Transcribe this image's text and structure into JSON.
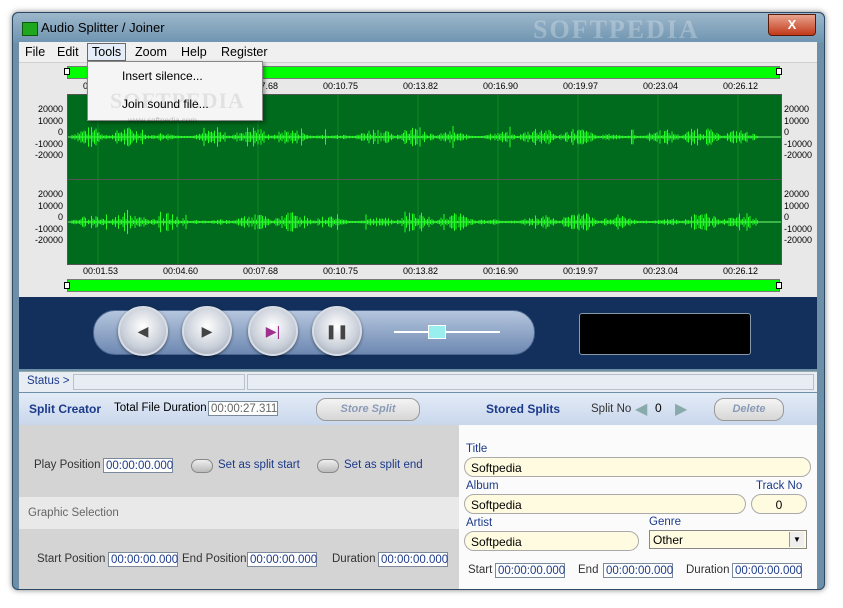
{
  "window": {
    "title": "Audio Splitter / Joiner",
    "close_label": "X"
  },
  "watermark": "SOFTPEDIA",
  "menu": [
    "File",
    "Edit",
    "Tools",
    "Zoom",
    "Help",
    "Register"
  ],
  "tools_menu": {
    "items": [
      "Insert silence...",
      "Join sound file..."
    ],
    "watermark": "SOFTPEDIA",
    "watermark_url": "www.softpedia.com"
  },
  "timeline": {
    "ticks": [
      "00:01.53",
      "00:04.60",
      "00:07.68",
      "00:10.75",
      "00:13.82",
      "00:16.90",
      "00:19.97",
      "00:23.04",
      "00:26.12"
    ]
  },
  "amplitude_labels": [
    "20000",
    "10000",
    "0",
    "-10000",
    "-20000"
  ],
  "colors": {
    "waveform": "#00ff00",
    "wave_bg": "#006b1c",
    "transport_bg": "#13305c",
    "accent_text": "#1b3a8a"
  },
  "transport": {
    "buttons": [
      "rewind",
      "play",
      "skip-marked",
      "pause"
    ],
    "icons": {
      "rewind": "◀",
      "play": "▶",
      "skip": "▶|",
      "pause": "❚❚"
    }
  },
  "status": {
    "label": "Status >"
  },
  "split_creator": {
    "title": "Split Creator",
    "total_duration_label": "Total File Duration",
    "total_duration_value": "00:00:27.311",
    "store_split_label": "Store Split",
    "play_position_label": "Play Position",
    "play_position_value": "00:00:00.000",
    "set_start_label": "Set as split start",
    "set_end_label": "Set as split end",
    "graphic_selection_label": "Graphic Selection",
    "start_position_label": "Start Position",
    "start_position_value": "00:00:00.000",
    "end_position_label": "End Position",
    "end_position_value": "00:00:00.000",
    "duration_label": "Duration",
    "duration_value": "00:00:00.000"
  },
  "stored_splits": {
    "title": "Stored Splits",
    "split_no_label": "Split No",
    "split_no_value": "0",
    "delete_label": "Delete",
    "title_label": "Title",
    "title_value": "Softpedia",
    "album_label": "Album",
    "album_value": "Softpedia",
    "track_no_label": "Track No",
    "track_no_value": "0",
    "artist_label": "Artist",
    "artist_value": "Softpedia",
    "genre_label": "Genre",
    "genre_value": "Other",
    "start_label": "Start",
    "start_value": "00:00:00.000",
    "end_label": "End",
    "end_value": "00:00:00.000",
    "duration_label": "Duration",
    "duration_value": "00:00:00.000"
  }
}
